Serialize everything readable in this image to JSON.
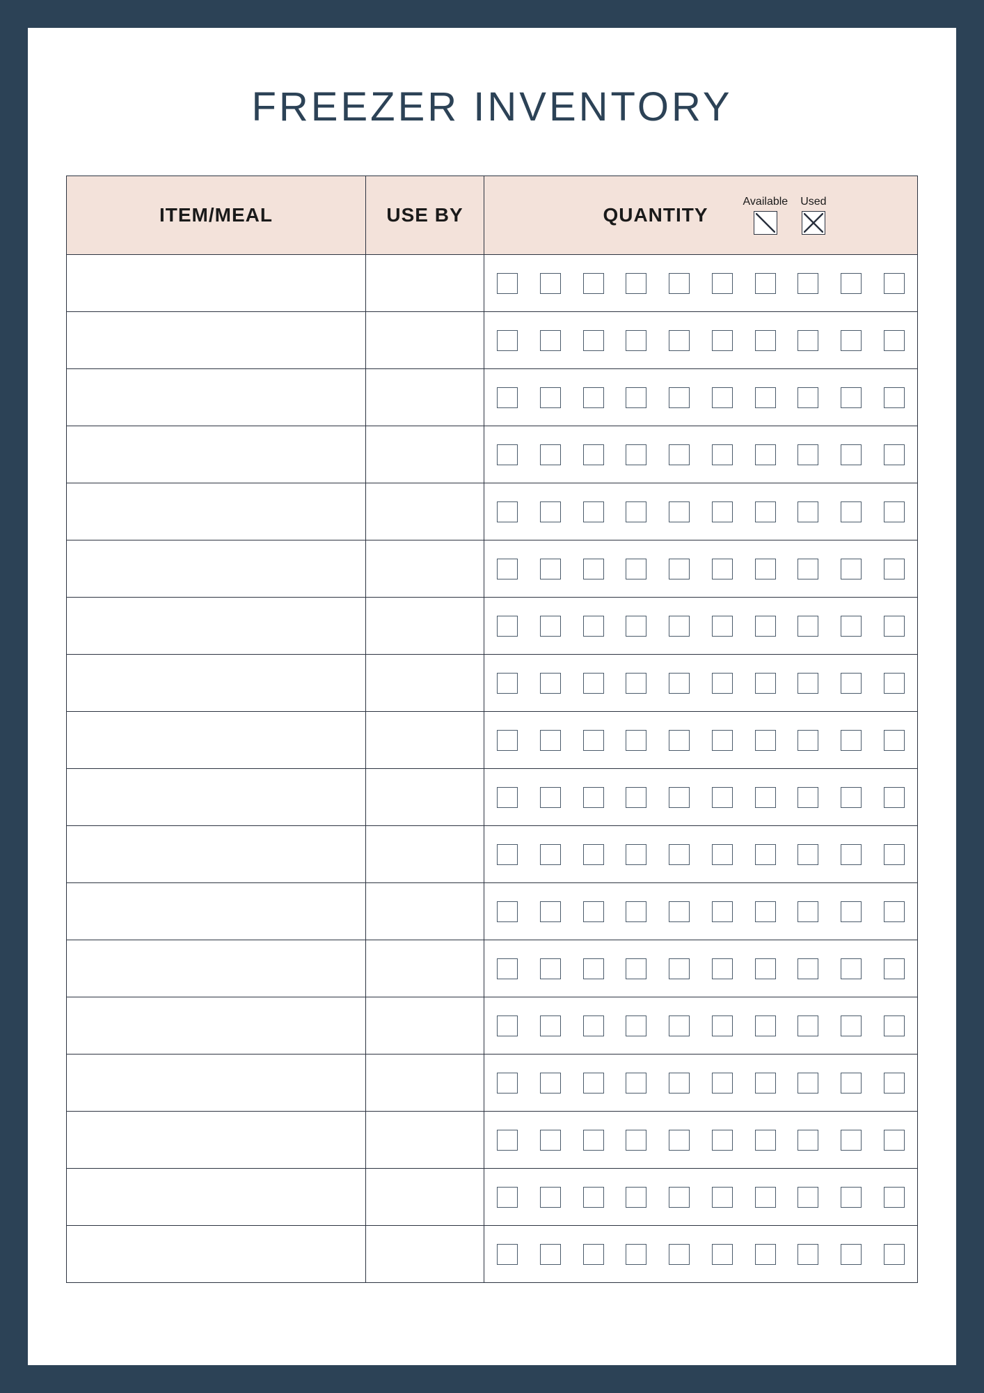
{
  "title": "FREEZER INVENTORY",
  "columns": {
    "item": "ITEM/MEAL",
    "useby": "USE BY",
    "quantity": "QUANTITY"
  },
  "legend": {
    "available": "Available",
    "used": "Used"
  },
  "row_count": 18,
  "checkboxes_per_row": 10,
  "colors": {
    "frame": "#2c4256",
    "header_bg": "#f3e2da",
    "border": "#2c3340"
  }
}
